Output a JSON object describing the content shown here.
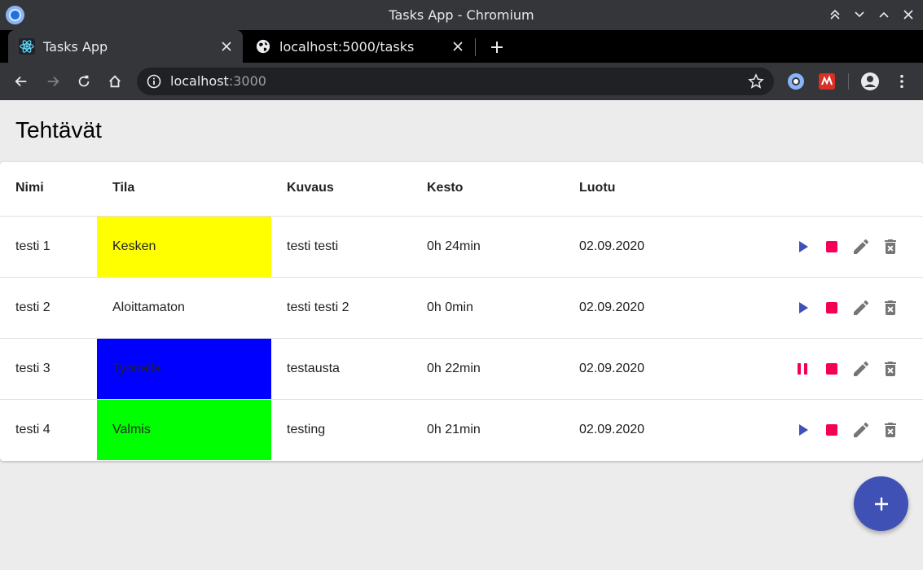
{
  "window": {
    "title": "Tasks App - Chromium"
  },
  "tabs": [
    {
      "label": "Tasks App",
      "icon": "react-icon",
      "active": true
    },
    {
      "label": "localhost:5000/tasks",
      "icon": "globe-icon",
      "active": false
    }
  ],
  "address_bar": {
    "host": "localhost",
    "port": ":3000"
  },
  "page": {
    "title": "Tehtävät"
  },
  "table": {
    "headers": {
      "name": "Nimi",
      "status": "Tila",
      "description": "Kuvaus",
      "duration": "Kesto",
      "created": "Luotu"
    },
    "rows": [
      {
        "name": "testi 1",
        "status": "Kesken",
        "status_color": "#ffff00",
        "description": "testi testi",
        "duration": "0h 24min",
        "created": "02.09.2020",
        "running": false
      },
      {
        "name": "testi 2",
        "status": "Aloittamaton",
        "status_color": "#ffffff",
        "description": "testi testi 2",
        "duration": "0h 0min",
        "created": "02.09.2020",
        "running": false
      },
      {
        "name": "testi 3",
        "status": "Työnalla",
        "status_color": "#0000ff",
        "description": "testausta",
        "duration": "0h 22min",
        "created": "02.09.2020",
        "running": true
      },
      {
        "name": "testi 4",
        "status": "Valmis",
        "status_color": "#00ff00",
        "description": "testing",
        "duration": "0h 21min",
        "created": "02.09.2020",
        "running": false
      }
    ]
  },
  "colors": {
    "primary": "#3f51b5",
    "secondary": "#f50057",
    "icon_grey": "#757575"
  }
}
